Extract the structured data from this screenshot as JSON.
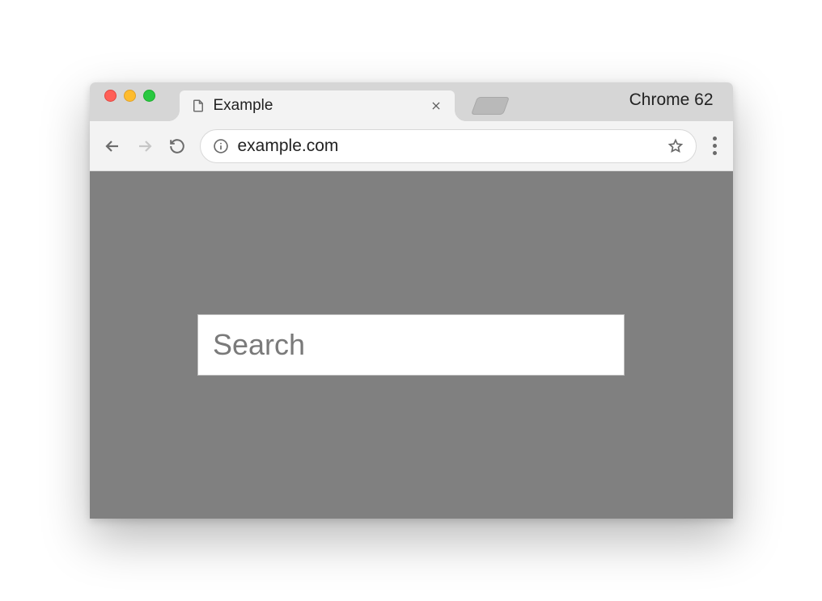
{
  "window": {
    "browser_label": "Chrome 62",
    "tab": {
      "title": "Example"
    },
    "addressbar": {
      "url": "example.com"
    }
  },
  "page": {
    "search": {
      "placeholder": "Search",
      "value": ""
    }
  }
}
